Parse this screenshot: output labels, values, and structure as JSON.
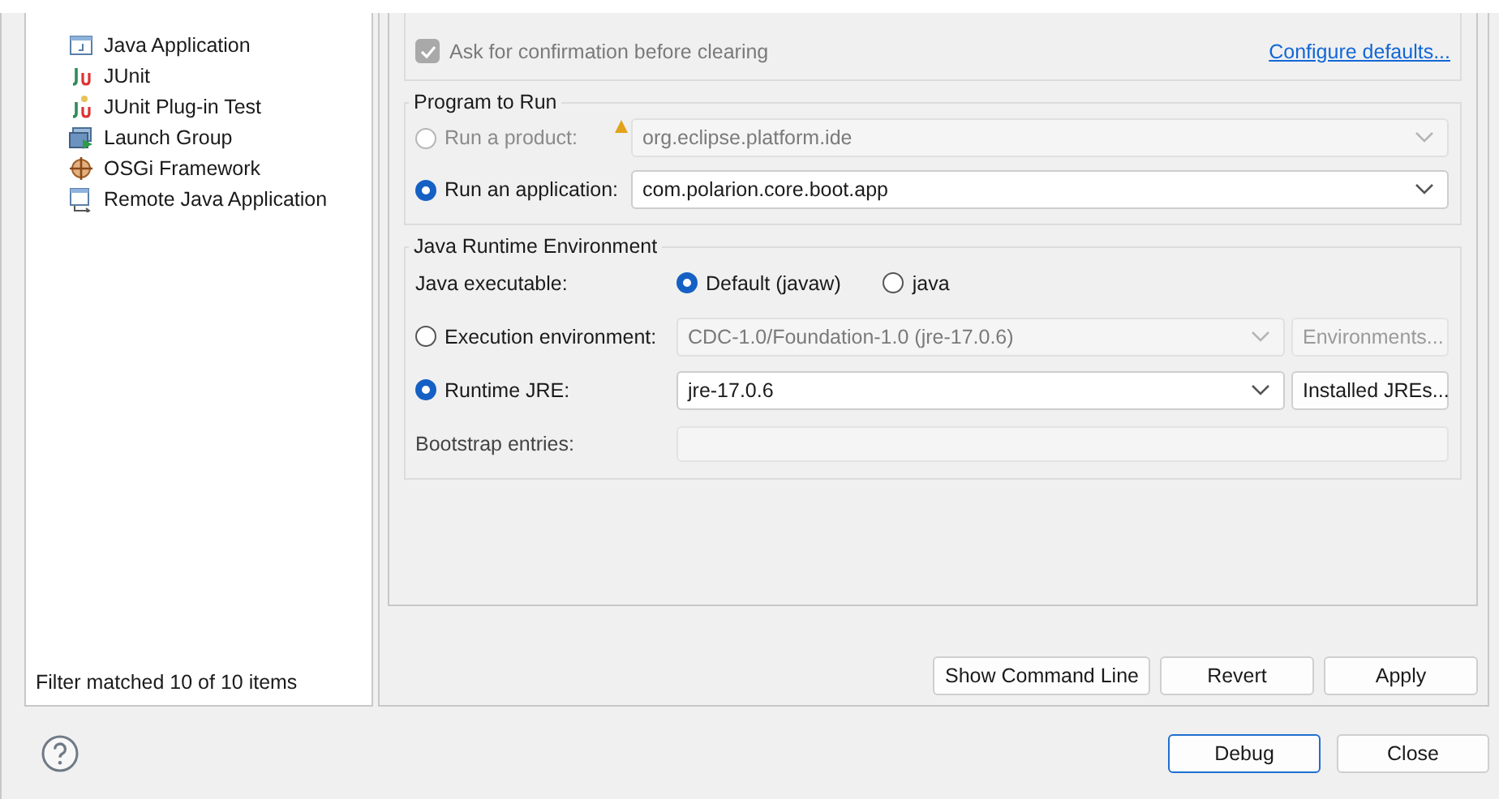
{
  "tree": {
    "items": [
      {
        "label": "Java Application",
        "kind": "window"
      },
      {
        "label": "JUnit",
        "kind": "junit"
      },
      {
        "label": "JUnit Plug-in Test",
        "kind": "junit-plugin"
      },
      {
        "label": "Launch Group",
        "kind": "group"
      },
      {
        "label": "OSGi Framework",
        "kind": "osgi"
      },
      {
        "label": "Remote Java Application",
        "kind": "remote"
      }
    ],
    "filter_status": "Filter matched 10 of 10 items"
  },
  "clear_options": {
    "confirm": {
      "label": "Ask for confirmation before clearing",
      "checked": true,
      "disabled": true
    },
    "configure_link": "Configure defaults..."
  },
  "program_to_run": {
    "title": "Program to Run",
    "options": [
      {
        "label": "Run a product:",
        "selected": false,
        "disabled": true,
        "field_disabled": true,
        "warning": true,
        "value": "org.eclipse.platform.ide"
      },
      {
        "label": "Run an application:",
        "selected": true,
        "disabled": false,
        "field_disabled": false,
        "warning": false,
        "value": "com.polarion.core.boot.app"
      }
    ]
  },
  "jre": {
    "title": "Java Runtime Environment",
    "executable_label": "Java executable:",
    "executables": [
      {
        "label": "Default (javaw)",
        "selected": true
      },
      {
        "label": "java",
        "selected": false
      }
    ],
    "options": [
      {
        "label": "Execution environment:",
        "selected": false,
        "field_disabled": true,
        "value": "CDC-1.0/Foundation-1.0 (jre-17.0.6)",
        "button": "Environments...",
        "button_disabled": true
      },
      {
        "label": "Runtime JRE:",
        "selected": true,
        "field_disabled": false,
        "value": "jre-17.0.6",
        "button": "Installed JREs...",
        "button_disabled": false
      }
    ],
    "bootstrap_label": "Bootstrap entries:"
  },
  "tab_buttons": [
    "Show Command Line",
    "Revert",
    "Apply"
  ],
  "dialog_buttons": [
    {
      "label": "Debug",
      "default": true
    },
    {
      "label": "Close",
      "default": false
    }
  ]
}
